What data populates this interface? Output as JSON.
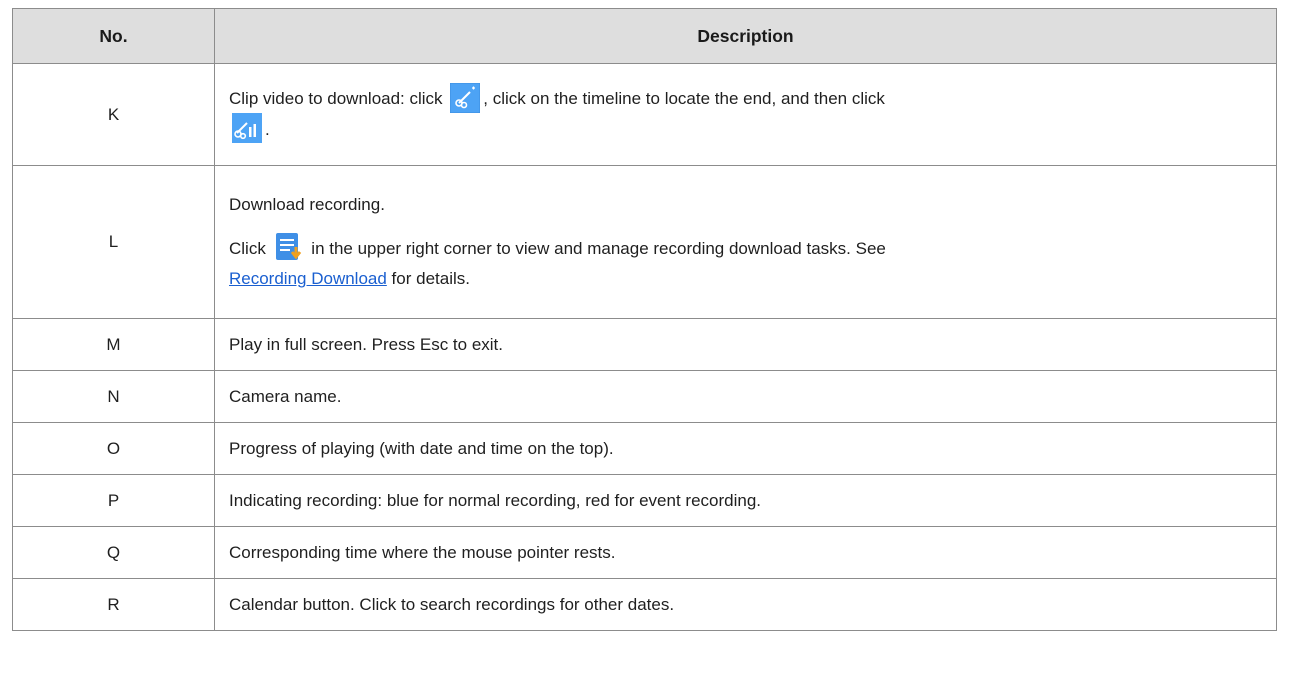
{
  "table": {
    "headers": {
      "no": "No.",
      "description": "Description"
    },
    "rows": [
      {
        "no": "K",
        "desc_a": "Clip video to download: click ",
        "icon1": "clip-start-icon",
        "desc_b": ", click on the timeline to locate the end, and then click",
        "icon2": "clip-end-icon",
        "desc_c": "."
      },
      {
        "no": "L",
        "line1": "Download recording.",
        "line2_a": "Click ",
        "icon": "download-tasks-icon",
        "line2_b": " in the upper right corner to view and manage recording download tasks. See",
        "link": "Recording Download",
        "line3_b": " for details."
      },
      {
        "no": "M",
        "desc": "Play in full screen. Press Esc to exit."
      },
      {
        "no": "N",
        "desc": "Camera name."
      },
      {
        "no": "O",
        "desc": "Progress of playing (with date and time on the top)."
      },
      {
        "no": "P",
        "desc": "Indicating recording: blue for normal recording, red for event recording."
      },
      {
        "no": "Q",
        "desc": "Corresponding time where the mouse pointer rests."
      },
      {
        "no": "R",
        "desc": "Calendar button. Click to search recordings for other dates."
      }
    ]
  },
  "colors": {
    "header_bg": "#dedede",
    "border": "#8c8c8c",
    "icon_blue": "#4da3f5",
    "link": "#1a5fd0"
  }
}
